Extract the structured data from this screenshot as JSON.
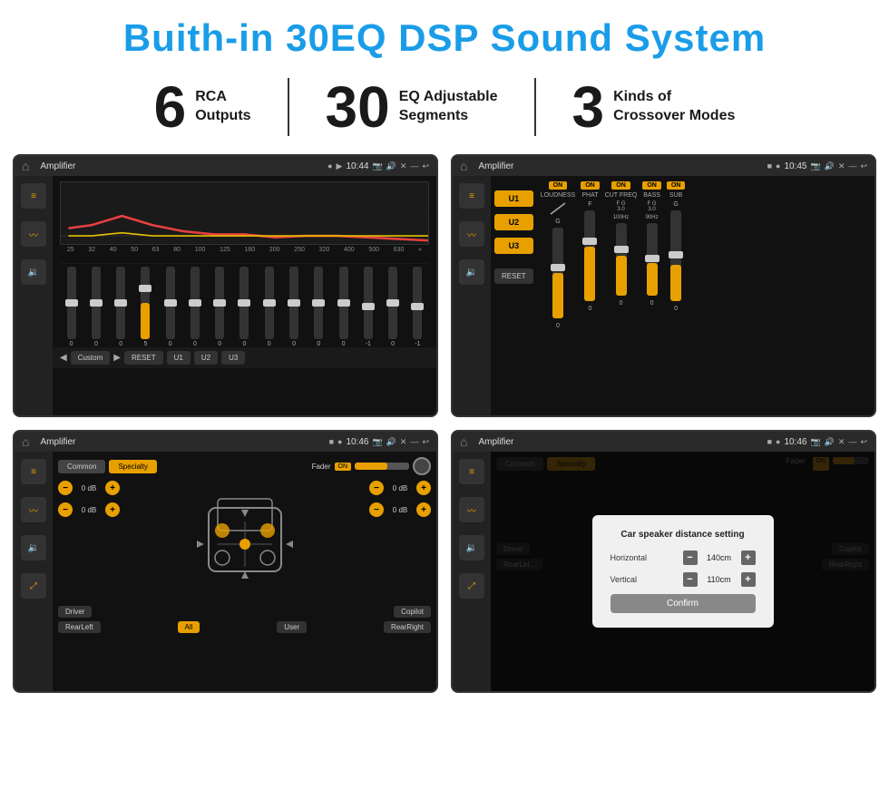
{
  "title": "Buith-in 30EQ DSP Sound System",
  "stats": [
    {
      "number": "6",
      "line1": "RCA",
      "line2": "Outputs"
    },
    {
      "number": "30",
      "line1": "EQ Adjustable",
      "line2": "Segments"
    },
    {
      "number": "3",
      "line1": "Kinds of",
      "line2": "Crossover Modes"
    }
  ],
  "screens": [
    {
      "id": "eq-screen",
      "status": {
        "title": "Amplifier",
        "time": "10:44"
      },
      "type": "eq"
    },
    {
      "id": "crossover-screen",
      "status": {
        "title": "Amplifier",
        "time": "10:45"
      },
      "type": "crossover"
    },
    {
      "id": "speaker-screen",
      "status": {
        "title": "Amplifier",
        "time": "10:46"
      },
      "type": "speaker"
    },
    {
      "id": "dialog-screen",
      "status": {
        "title": "Amplifier",
        "time": "10:46"
      },
      "type": "dialog"
    }
  ],
  "eq": {
    "frequencies": [
      "25",
      "32",
      "40",
      "50",
      "63",
      "80",
      "100",
      "125",
      "160",
      "200",
      "250",
      "320",
      "400",
      "500",
      "630"
    ],
    "values": [
      "0",
      "0",
      "0",
      "5",
      "0",
      "0",
      "0",
      "0",
      "0",
      "0",
      "0",
      "0",
      "-1",
      "0",
      "-1"
    ],
    "bottomBtns": [
      "Custom",
      "RESET",
      "U1",
      "U2",
      "U3"
    ]
  },
  "crossover": {
    "presets": [
      "U1",
      "U2",
      "U3"
    ],
    "channels": [
      {
        "label": "LOUDNESS",
        "on": true
      },
      {
        "label": "PHAT",
        "on": true
      },
      {
        "label": "CUT FREQ",
        "on": true
      },
      {
        "label": "BASS",
        "on": true
      },
      {
        "label": "SUB",
        "on": true
      }
    ],
    "resetLabel": "RESET"
  },
  "speaker": {
    "tabs": [
      "Common",
      "Specialty"
    ],
    "faderLabel": "Fader",
    "faderOn": "ON",
    "dbRows": [
      {
        "value": "0 dB"
      },
      {
        "value": "0 dB"
      },
      {
        "value": "0 dB"
      },
      {
        "value": "0 dB"
      }
    ],
    "bottomBtns": [
      "Driver",
      "Copilot",
      "RearLeft",
      "All",
      "User",
      "RearRight"
    ]
  },
  "dialog": {
    "title": "Car speaker distance setting",
    "rows": [
      {
        "label": "Horizontal",
        "value": "140cm"
      },
      {
        "label": "Vertical",
        "value": "110cm"
      }
    ],
    "confirmLabel": "Confirm"
  }
}
